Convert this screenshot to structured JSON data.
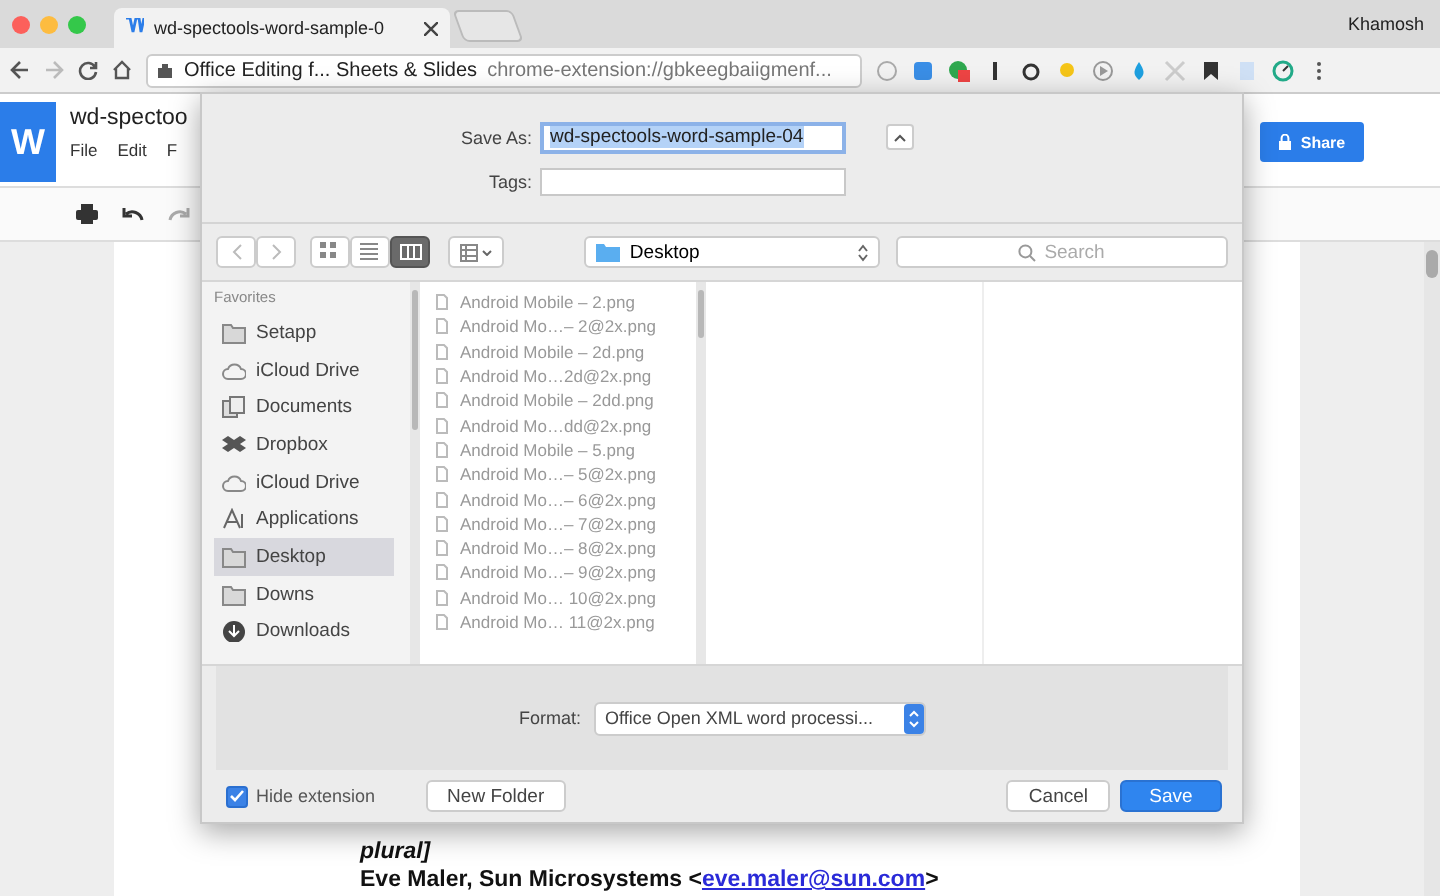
{
  "browser": {
    "tab_title": "wd-spectools-word-sample-0",
    "profile": "Khamosh",
    "site_chip": "Office Editing f... Sheets & Slides",
    "url": "chrome-extension://gbkeegbaiigmenf..."
  },
  "docs": {
    "logo": "W",
    "title": "wd-spectoo",
    "menu": [
      "File",
      "Edit",
      "F"
    ],
    "share": "Share",
    "body": {
      "note": "plural]",
      "author": "Eve Maler, Sun Microsystems <",
      "email": "eve.maler@sun.com",
      "author_end": ">"
    }
  },
  "dialog": {
    "save_as_label": "Save As:",
    "filename": "wd-spectools-word-sample-04",
    "tags_label": "Tags:",
    "view_modes": [
      {
        "kind": "icons",
        "selected": false
      },
      {
        "kind": "list",
        "selected": false
      },
      {
        "kind": "columns",
        "selected": true
      }
    ],
    "location": "Desktop",
    "search_placeholder": "Search",
    "sidebar": {
      "heading": "Favorites",
      "items": [
        {
          "label": "Setapp",
          "kind": "folder",
          "selected": false
        },
        {
          "label": "iCloud Drive",
          "kind": "cloud",
          "selected": false
        },
        {
          "label": "Documents",
          "kind": "documents",
          "selected": false
        },
        {
          "label": "Dropbox",
          "kind": "dropbox",
          "selected": false
        },
        {
          "label": "iCloud Drive",
          "kind": "cloud",
          "selected": false
        },
        {
          "label": "Applications",
          "kind": "apps",
          "selected": false
        },
        {
          "label": "Desktop",
          "kind": "folder",
          "selected": true
        },
        {
          "label": "Downs",
          "kind": "folder",
          "selected": false
        },
        {
          "label": "Downloads",
          "kind": "download",
          "selected": false
        }
      ]
    },
    "files": [
      "Android Mobile – 2.png",
      "Android Mo…– 2@2x.png",
      "Android Mobile – 2d.png",
      "Android Mo…2d@2x.png",
      "Android Mobile – 2dd.png",
      "Android Mo…dd@2x.png",
      "Android Mobile – 5.png",
      "Android Mo…– 5@2x.png",
      "Android Mo…– 6@2x.png",
      "Android Mo…– 7@2x.png",
      "Android Mo…– 8@2x.png",
      "Android Mo…– 9@2x.png",
      "Android Mo… 10@2x.png",
      "Android Mo… 11@2x.png"
    ],
    "format_label": "Format:",
    "format_value": "Office Open XML word processi...",
    "hide_extension": {
      "label": "Hide extension",
      "checked": true
    },
    "buttons": [
      {
        "label": "New Folder",
        "kind": "normal"
      },
      {
        "label": "Cancel",
        "kind": "normal"
      },
      {
        "label": "Save",
        "kind": "default"
      }
    ]
  }
}
